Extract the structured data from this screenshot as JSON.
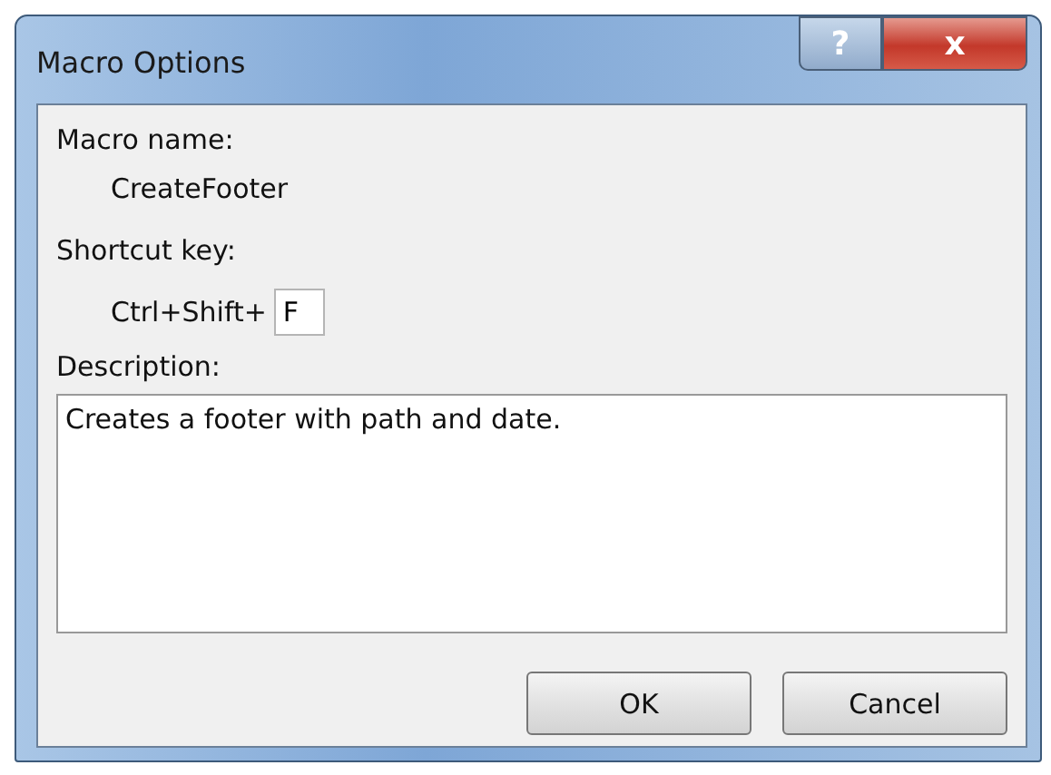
{
  "window": {
    "title": "Macro Options",
    "help_button": "?",
    "close_button": "x"
  },
  "macro_name": {
    "label": "Macro name:",
    "value": "CreateFooter"
  },
  "shortcut": {
    "label": "Shortcut key:",
    "prefix": "Ctrl+Shift+",
    "value": "F"
  },
  "description": {
    "label": "Description:",
    "value": "Creates a footer with path and date."
  },
  "buttons": [
    "OK",
    "Cancel"
  ]
}
